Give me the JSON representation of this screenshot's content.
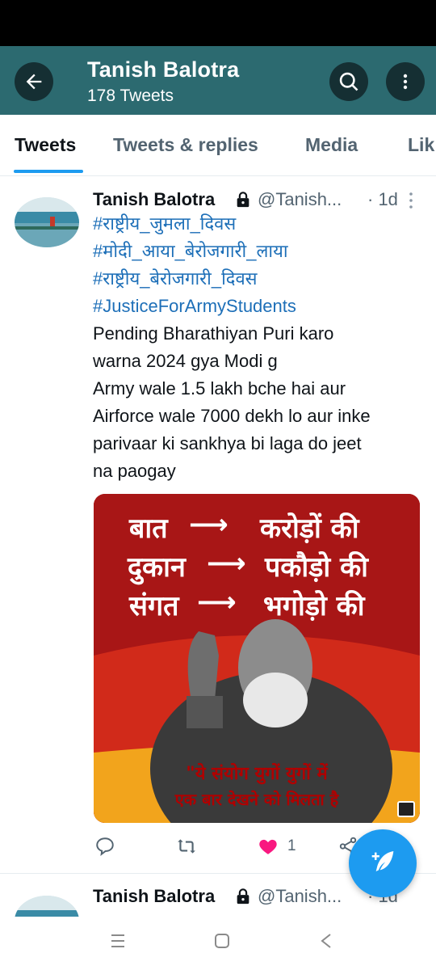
{
  "header": {
    "title": "Tanish Balotra",
    "subtitle": "178 Tweets"
  },
  "tabs": [
    {
      "label": "Tweets"
    },
    {
      "label": "Tweets & replies"
    },
    {
      "label": "Media"
    },
    {
      "label": "Lik"
    }
  ],
  "tweets": [
    {
      "name": "Tanish Balotra",
      "handle": "@Tanish...",
      "time": "· 1d",
      "hashtags": [
        "#राष्ट्रीय_जुमला_दिवस",
        "#मोदी_आया_बेरोजगारी_लाया",
        "#राष्ट्रीय_बेरोजगारी_दिवस",
        "#JusticeForArmyStudents"
      ],
      "text_lines": [
        "Pending Bharathiyan Puri karo",
        "warna 2024 gya Modi g",
        "Army wale 1.5 lakh bche hai aur",
        "Airforce wale 7000 dekh lo aur inke",
        "parivaar ki sankhya bi laga do jeet",
        "na paogay"
      ],
      "media": {
        "lines": [
          {
            "left": "बात",
            "right": "करोड़ों की"
          },
          {
            "left": "दुकान",
            "right": "पकौड़ो की"
          },
          {
            "left": "संगत",
            "right": "भगोड़ो की"
          }
        ],
        "arrow": "⟶",
        "quote_line1": "\"ये संयोग युगों युगों में",
        "quote_line2": "एक बार देखने को मिलता है"
      },
      "likes": "1"
    },
    {
      "name": "Tanish Balotra",
      "handle": "@Tanish...",
      "time": "· 1d"
    }
  ],
  "colors": {
    "header_bg": "#2c6a70",
    "accent": "#1d9bf0",
    "like": "#f91880"
  }
}
